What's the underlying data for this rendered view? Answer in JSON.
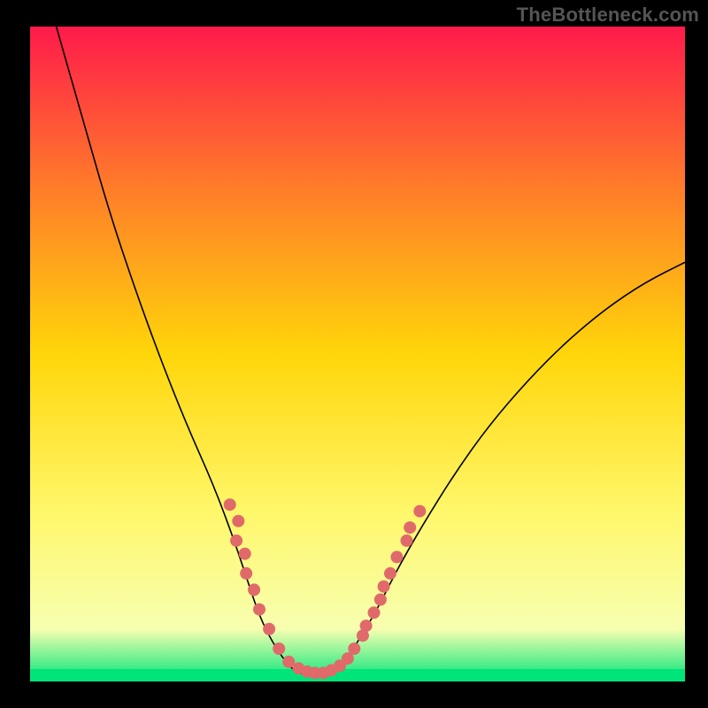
{
  "watermark": "TheBottleneck.com",
  "chart_data": {
    "type": "line",
    "title": "",
    "xlabel": "",
    "ylabel": "",
    "xlim": [
      0,
      100
    ],
    "ylim": [
      0,
      100
    ],
    "grid": false,
    "legend": false,
    "background_gradient": {
      "top": "#ff1a4b",
      "mid_upper": "#ff7a2a",
      "mid": "#ffd60a",
      "mid_lower": "#fff76a",
      "near_bottom": "#f7ffb0",
      "bottom": "#00e57a"
    },
    "bottom_band_color": "#00e57a",
    "curve": {
      "color": "#000000",
      "stroke_width": 1.6,
      "points_xy": [
        [
          4,
          100
        ],
        [
          8,
          86
        ],
        [
          12,
          72
        ],
        [
          16,
          60
        ],
        [
          20,
          49
        ],
        [
          24,
          39
        ],
        [
          28,
          30
        ],
        [
          31,
          22
        ],
        [
          33,
          16
        ],
        [
          35,
          10
        ],
        [
          37,
          6
        ],
        [
          39,
          3
        ],
        [
          40.5,
          1.5
        ],
        [
          42,
          1
        ],
        [
          44,
          1
        ],
        [
          46,
          1.5
        ],
        [
          48,
          3
        ],
        [
          50,
          6
        ],
        [
          53,
          11
        ],
        [
          56,
          17
        ],
        [
          60,
          24
        ],
        [
          65,
          32
        ],
        [
          70,
          39
        ],
        [
          76,
          46
        ],
        [
          82,
          52
        ],
        [
          88,
          57
        ],
        [
          94,
          61
        ],
        [
          100,
          64
        ]
      ]
    },
    "dots": {
      "color": "#e06a6a",
      "radius": 7,
      "points_xy": [
        [
          30.5,
          27
        ],
        [
          31.8,
          24.5
        ],
        [
          31.5,
          21.5
        ],
        [
          32.8,
          19.5
        ],
        [
          33.0,
          16.5
        ],
        [
          34.2,
          14.0
        ],
        [
          35.0,
          11.0
        ],
        [
          36.5,
          8.0
        ],
        [
          38.0,
          5.0
        ],
        [
          39.5,
          3.0
        ],
        [
          41.0,
          2.0
        ],
        [
          42.3,
          1.5
        ],
        [
          43.5,
          1.3
        ],
        [
          44.8,
          1.3
        ],
        [
          46.0,
          1.7
        ],
        [
          47.3,
          2.4
        ],
        [
          48.5,
          3.5
        ],
        [
          49.5,
          5.0
        ],
        [
          50.8,
          7.0
        ],
        [
          51.3,
          8.5
        ],
        [
          52.5,
          10.5
        ],
        [
          53.5,
          12.5
        ],
        [
          54.0,
          14.5
        ],
        [
          55.0,
          16.5
        ],
        [
          56.0,
          19.0
        ],
        [
          57.5,
          21.5
        ],
        [
          58.0,
          23.5
        ],
        [
          59.5,
          26.0
        ]
      ]
    }
  }
}
